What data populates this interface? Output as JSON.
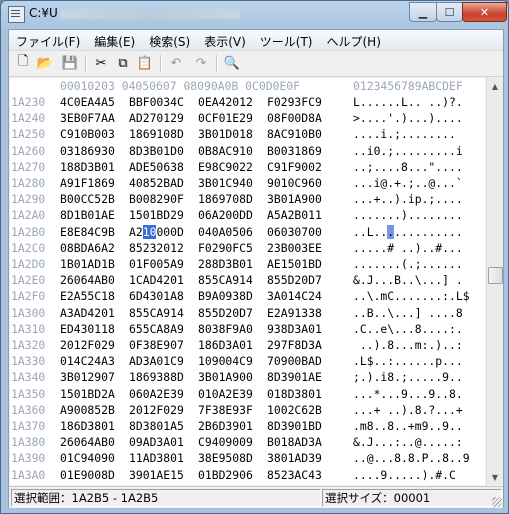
{
  "window": {
    "title": "C:¥U"
  },
  "menu": [
    {
      "label": "ファイル(F)"
    },
    {
      "label": "編集(E)"
    },
    {
      "label": "検索(S)"
    },
    {
      "label": "表示(V)"
    },
    {
      "label": "ツール(T)"
    },
    {
      "label": "ヘルプ(H)"
    }
  ],
  "toolbar": [
    {
      "name": "new-icon",
      "glyph": "🗋"
    },
    {
      "name": "open-folder-icon",
      "glyph": "📂"
    },
    {
      "name": "save-icon",
      "glyph": "💾"
    },
    {
      "name": "cut-icon",
      "glyph": "✂"
    },
    {
      "name": "copy-icon",
      "glyph": "⧉"
    },
    {
      "name": "paste-icon",
      "glyph": "📋"
    },
    {
      "name": "undo-icon",
      "glyph": "↶"
    },
    {
      "name": "redo-icon",
      "glyph": "↷"
    },
    {
      "name": "find-icon",
      "glyph": "🔍"
    }
  ],
  "hex_header": {
    "offsets": "00010203 04050607 08090A0B 0C0D0E0F",
    "ascii": "0123456789ABCDEF"
  },
  "rows": [
    {
      "addr": "1A230",
      "g": [
        "4C0EA4A5",
        "BBF0034C",
        "0EA42012",
        "F0293FC9"
      ],
      "asc": "L......L.. ..)?."
    },
    {
      "addr": "1A240",
      "g": [
        "3EB0F7AA",
        "AD270129",
        "0CF01E29",
        "08F00D8A"
      ],
      "asc": ">....'.)...)...."
    },
    {
      "addr": "1A250",
      "g": [
        "C910B003",
        "1869108D",
        "3B01D018",
        "8AC910B0"
      ],
      "asc": "....i.;........"
    },
    {
      "addr": "1A260",
      "g": [
        "03186930",
        "8D3B01D0",
        "0B8AC910",
        "B0031869"
      ],
      "asc": "..i0.;.........i"
    },
    {
      "addr": "1A270",
      "g": [
        "188D3B01",
        "ADE50638",
        "E98C9022",
        "C91F9002"
      ],
      "asc": "..;....8...\"...."
    },
    {
      "addr": "1A280",
      "g": [
        "A91F1869",
        "40852BAD",
        "3B01C940",
        "9010C960"
      ],
      "asc": "...i@.+.;..@...`"
    },
    {
      "addr": "1A290",
      "g": [
        "B00CC52B",
        "B008290F",
        "1869708D",
        "3B01A900"
      ],
      "asc": "...+..).ip.;...."
    },
    {
      "addr": "1A2A0",
      "g": [
        "8D1B01AE",
        "1501BD29",
        "06A200DD",
        "A5A2B011"
      ],
      "asc": ".......)........"
    },
    {
      "addr": "1A2B0",
      "g": [
        "E8E84C9B",
        "A210000D",
        "040A0506",
        "06030700"
      ],
      "asc": "..L.............",
      "sel": true
    },
    {
      "addr": "1A2C0",
      "g": [
        "08BDA6A2",
        "85232012",
        "F0290FC5",
        "23B003EE"
      ],
      "asc": ".....# ..)..#..."
    },
    {
      "addr": "1A2D0",
      "g": [
        "1B01AD1B",
        "01F005A9",
        "288D3B01",
        "AE1501BD"
      ],
      "asc": ".......(.;......"
    },
    {
      "addr": "1A2E0",
      "g": [
        "26064AB0",
        "1CAD4201",
        "855CA914",
        "855D20D7"
      ],
      "asc": "&.J...B..\\...] ."
    },
    {
      "addr": "1A2F0",
      "g": [
        "E2A55C18",
        "6D4301A8",
        "B9A0938D",
        "3A014C24"
      ],
      "asc": "..\\.mC.......:.L$"
    },
    {
      "addr": "1A300",
      "g": [
        "A3AD4201",
        "855CA914",
        "855D20D7",
        "E2A91338"
      ],
      "asc": "..B..\\...] ....8"
    },
    {
      "addr": "1A310",
      "g": [
        "ED430118",
        "655CA8A9",
        "8038F9A0",
        "938D3A01"
      ],
      "asc": ".C..e\\...8....:."
    },
    {
      "addr": "1A320",
      "g": [
        "2012F029",
        "0F38E907",
        "186D3A01",
        "297F8D3A"
      ],
      "asc": " ..).8...m:.)..:"
    },
    {
      "addr": "1A330",
      "g": [
        "014C24A3",
        "AD3A01C9",
        "109004C9",
        "70900BAD"
      ],
      "asc": ".L$..:......p..."
    },
    {
      "addr": "1A340",
      "g": [
        "3B012907",
        "1869388D",
        "3B01A900",
        "8D3901AE"
      ],
      "asc": ";.).i8.;.....9.."
    },
    {
      "addr": "1A350",
      "g": [
        "1501BD2A",
        "060A2E39",
        "010A2E39",
        "018D3801"
      ],
      "asc": "...*...9...9..8."
    },
    {
      "addr": "1A360",
      "g": [
        "A900852B",
        "2012F029",
        "7F38E93F",
        "1002C62B"
      ],
      "asc": "...+ ..).8.?...+"
    },
    {
      "addr": "1A370",
      "g": [
        "186D3801",
        "8D3801A5",
        "2B6D3901",
        "8D3901BD"
      ],
      "asc": ".m8..8..+m9..9.."
    },
    {
      "addr": "1A380",
      "g": [
        "26064AB0",
        "09AD3A01",
        "C9409009",
        "B018AD3A"
      ],
      "asc": "&.J...:..@.....:"
    },
    {
      "addr": "1A390",
      "g": [
        "01C94090",
        "11AD3801",
        "38E9508D",
        "3801AD39"
      ],
      "asc": "..@...8.8.P..8..9"
    },
    {
      "addr": "1A3A0",
      "g": [
        "01E9008D",
        "3901AE15",
        "01BD2906",
        "8523AC43"
      ],
      "asc": "....9.....).#.C"
    }
  ],
  "status": {
    "left_label": "選択範囲：1A2B5 - 1A2B5",
    "right_label": "選択サイズ：00001"
  }
}
